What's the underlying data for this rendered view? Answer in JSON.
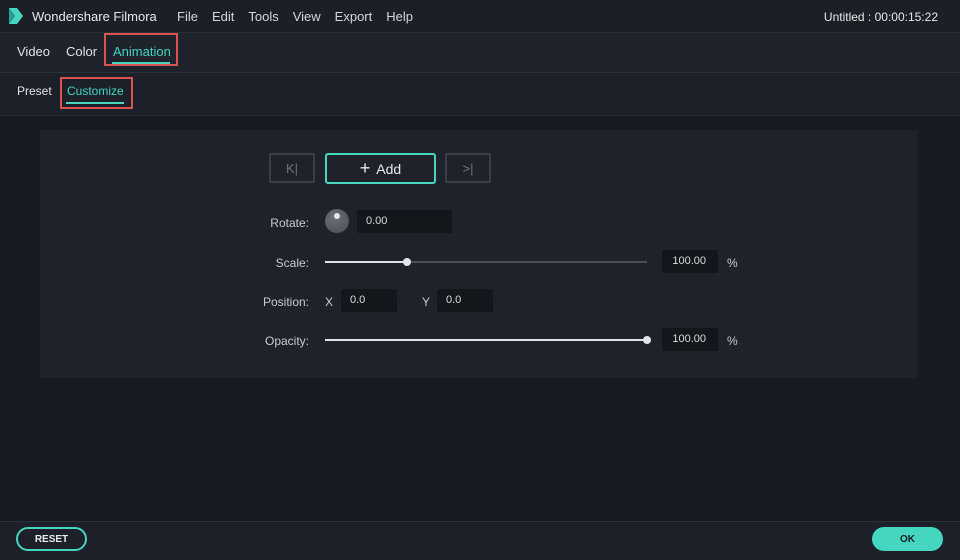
{
  "app": {
    "name": "Wondershare Filmora",
    "project_title": "Untitled : 00:00:15:22"
  },
  "menu": [
    "File",
    "Edit",
    "Tools",
    "View",
    "Export",
    "Help"
  ],
  "tabs": {
    "video": "Video",
    "color": "Color",
    "animation": "Animation",
    "active": "Animation"
  },
  "subtabs": {
    "preset": "Preset",
    "customize": "Customize",
    "active": "Customize"
  },
  "keyframes": {
    "prev_icon": "K|",
    "add_label": "Add",
    "next_icon": ">|"
  },
  "rotate": {
    "label": "Rotate:",
    "value": "0.00"
  },
  "scale": {
    "label": "Scale:",
    "value": "100.00",
    "unit": "%",
    "slider_fraction": 0.255
  },
  "position": {
    "label": "Position:",
    "x_label": "X",
    "x_value": "0.0",
    "y_label": "Y",
    "y_value": "0.0"
  },
  "opacity": {
    "label": "Opacity:",
    "value": "100.00",
    "unit": "%",
    "slider_fraction": 1.0
  },
  "footer": {
    "reset_label": "RESET",
    "ok_label": "OK"
  },
  "colors": {
    "accent": "#45d6c0",
    "highlight": "#d9534f",
    "background": "#191d25"
  }
}
